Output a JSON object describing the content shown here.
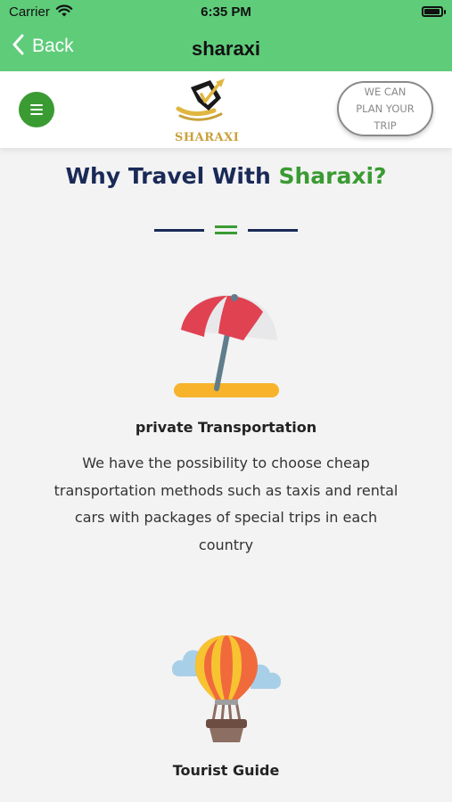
{
  "status_bar": {
    "carrier": "Carrier",
    "time": "6:35 PM",
    "battery_level": 0.95
  },
  "nav": {
    "back_label": "Back",
    "title": "sharaxi"
  },
  "header": {
    "logo_text": "SHARAXI",
    "plan_button_label": "WE CAN\nPLAN YOUR\nTRIP"
  },
  "section": {
    "title_part1": "Why Travel With ",
    "title_accent": "Sharaxi?"
  },
  "features": [
    {
      "icon": "beach-umbrella-icon",
      "title": "private Transportation",
      "description": "We have the possibility to choose cheap transportation methods such as taxis and rental cars with packages of special trips in each country"
    },
    {
      "icon": "hot-air-balloon-icon",
      "title": "Tourist Guide",
      "description": ""
    }
  ],
  "colors": {
    "nav_green": "#5fcc7a",
    "menu_green": "#3a9b33",
    "navy": "#1a2a57",
    "accent_green": "#3a9b33",
    "logo_gold": "#c9a13a"
  }
}
